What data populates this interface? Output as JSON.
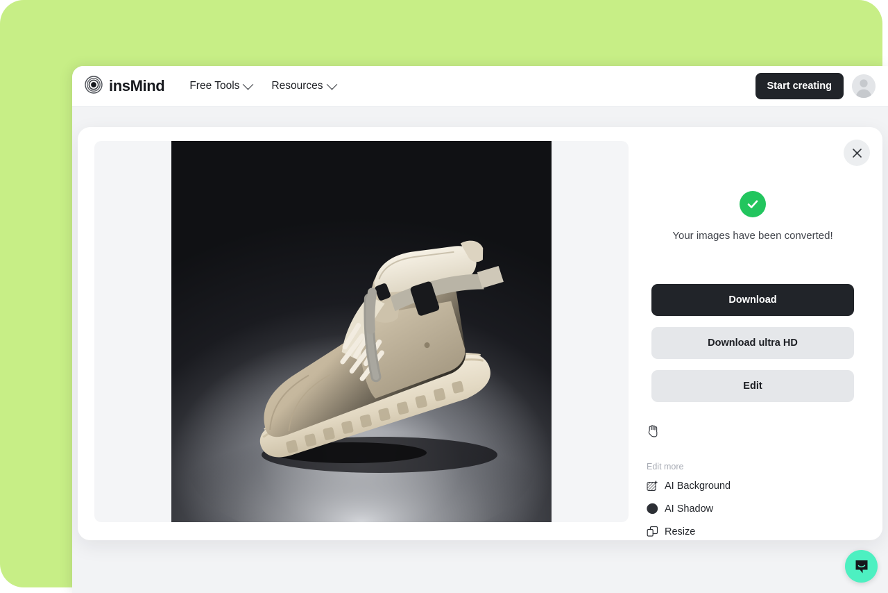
{
  "page": {
    "background_color": "#c7ee86"
  },
  "header": {
    "brand": {
      "name": "insMind",
      "logo_icon": "concentric-circles-logo"
    },
    "nav": [
      {
        "label": "Free Tools",
        "icon": "chevron-down-icon"
      },
      {
        "label": "Resources",
        "icon": "chevron-down-icon"
      }
    ],
    "cta": {
      "label": "Start creating",
      "bg_color": "#212429"
    },
    "avatar": {
      "icon": "default-user-avatar"
    }
  },
  "modal": {
    "close_icon": "close-icon",
    "preview": {
      "image_alt": "beige high-top sneaker boot on dark studio background",
      "canvas_bg": "#f4f5f7"
    },
    "panel": {
      "status_icon": "check-circle-icon",
      "status_icon_color": "#22c55e",
      "status_text": "Your images have been converted!",
      "buttons": [
        {
          "label": "Download",
          "style": "primary"
        },
        {
          "label": "Download ultra HD",
          "style": "secondary"
        },
        {
          "label": "Edit",
          "style": "secondary"
        }
      ],
      "cursor_icon": "grab-hand-icon",
      "edit_more": {
        "label": "Edit more",
        "items": [
          {
            "label": "AI Background",
            "icon": "ai-background-icon"
          },
          {
            "label": "AI Shadow",
            "icon": "ai-shadow-icon"
          },
          {
            "label": "Resize",
            "icon": "resize-icon"
          }
        ]
      }
    }
  },
  "chat_widget": {
    "icon": "chat-bubble-icon",
    "bg_color": "#4df0c1"
  }
}
